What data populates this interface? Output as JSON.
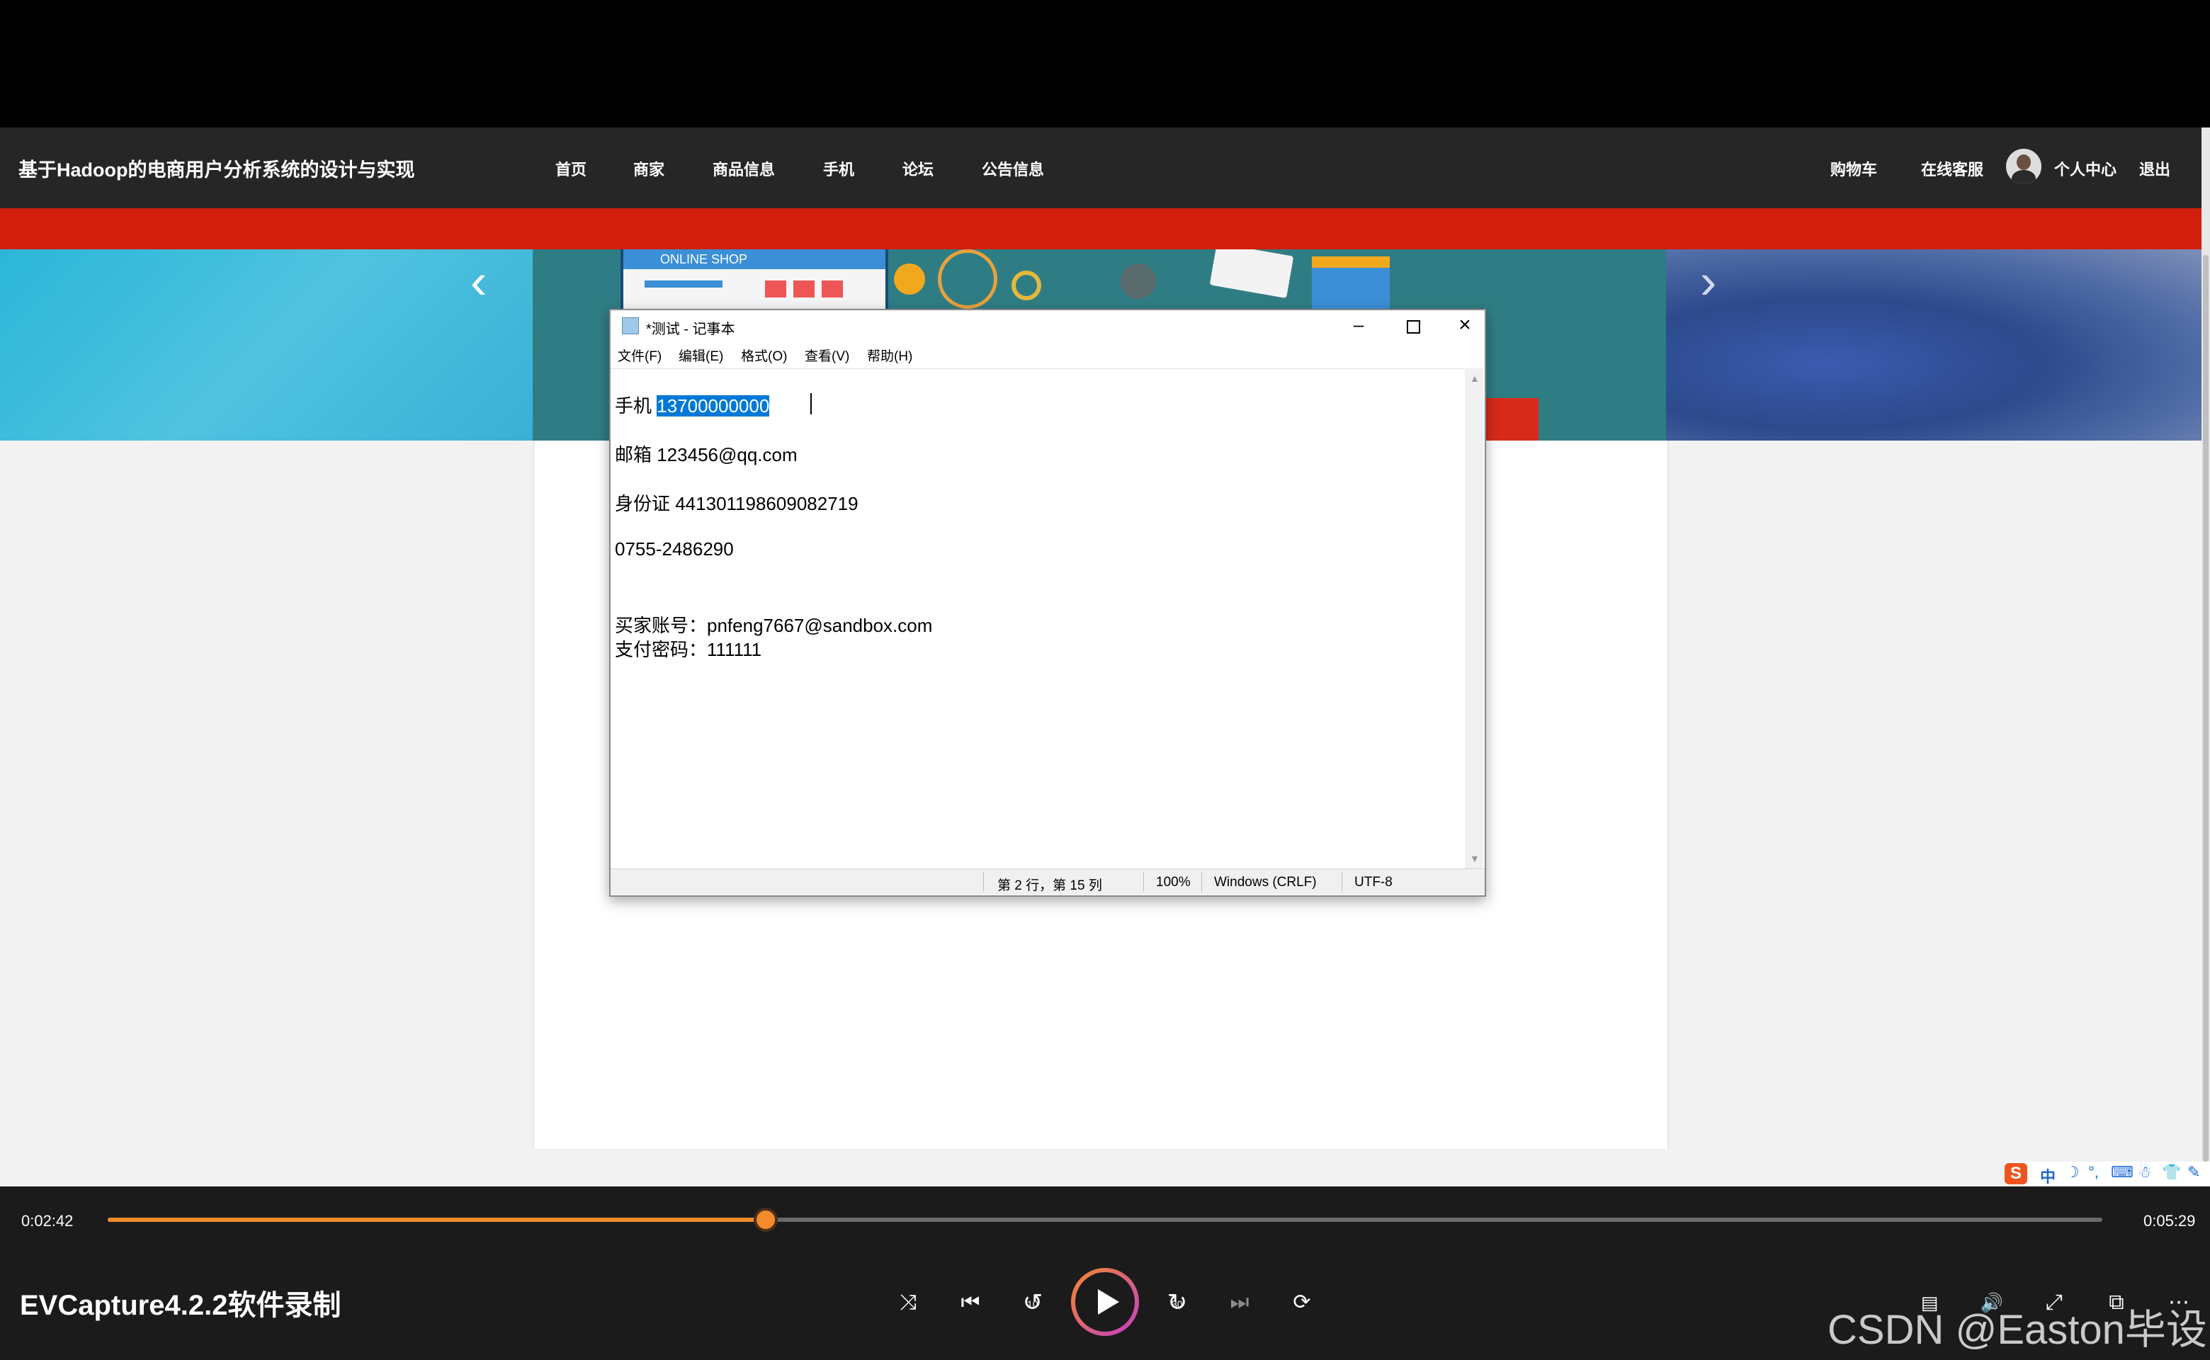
{
  "website": {
    "title": "基于Hadoop的电商用户分析系统的设计与实现",
    "nav": [
      "首页",
      "商家",
      "商品信息",
      "手机",
      "论坛",
      "公告信息"
    ],
    "right_nav": {
      "cart": "购物车",
      "service": "在线客服",
      "profile": "个人中心",
      "logout": "退出"
    },
    "banner_label": "ONLINE SHOP"
  },
  "notepad": {
    "title": "*测试 - 记事本",
    "menu": [
      "文件(F)",
      "编辑(E)",
      "格式(O)",
      "查看(V)",
      "帮助(H)"
    ],
    "lines": {
      "phone_label": "手机",
      "phone_value": "13700000000",
      "email": "邮箱 123456@qq.com",
      "idcard": "身份证 441301198609082719",
      "tel": "0755-2486290",
      "buyer": "买家账号：pnfeng7667@sandbox.com",
      "paypwd": "支付密码：111111"
    },
    "status": {
      "position": "第 2 行，第 15 列",
      "zoom": "100%",
      "eol": "Windows (CRLF)",
      "encoding": "UTF-8"
    }
  },
  "player": {
    "current_time": "0:02:42",
    "total_time": "0:05:29",
    "progress": 0.33,
    "title": "EVCapture4.2.2软件录制",
    "skip_back": "10",
    "skip_forward": "30"
  },
  "ime": {
    "label": "中"
  },
  "watermark": "CSDN @Easton毕设",
  "colors": {
    "accent": "#f48a2a",
    "redbar": "#d21f0e",
    "selection": "#0078d7"
  }
}
